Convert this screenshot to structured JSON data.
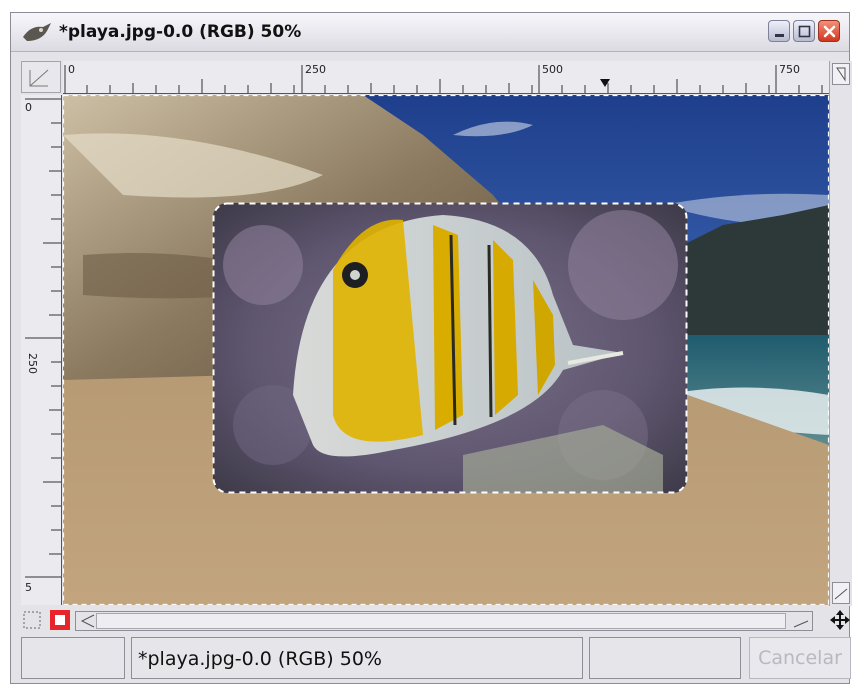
{
  "window": {
    "title": "*playa.jpg-0.0 (RGB) 50%"
  },
  "rulers": {
    "horizontal_labels": [
      "0",
      "250",
      "500",
      "750"
    ],
    "vertical_labels": [
      "0",
      "250",
      "5"
    ]
  },
  "status": {
    "image_label": "*playa.jpg-0.0 (RGB) 50%",
    "cancel_label": "Cancelar"
  },
  "icons": {
    "app": "wilber-icon",
    "minimize": "minimize-icon",
    "maximize": "maximize-icon",
    "close": "close-icon",
    "quickmask": "quick-mask-icon",
    "navigate": "navigate-icon"
  },
  "colors": {
    "close_button": "#d2361e",
    "selection_marching_ants": "#ffffff"
  }
}
